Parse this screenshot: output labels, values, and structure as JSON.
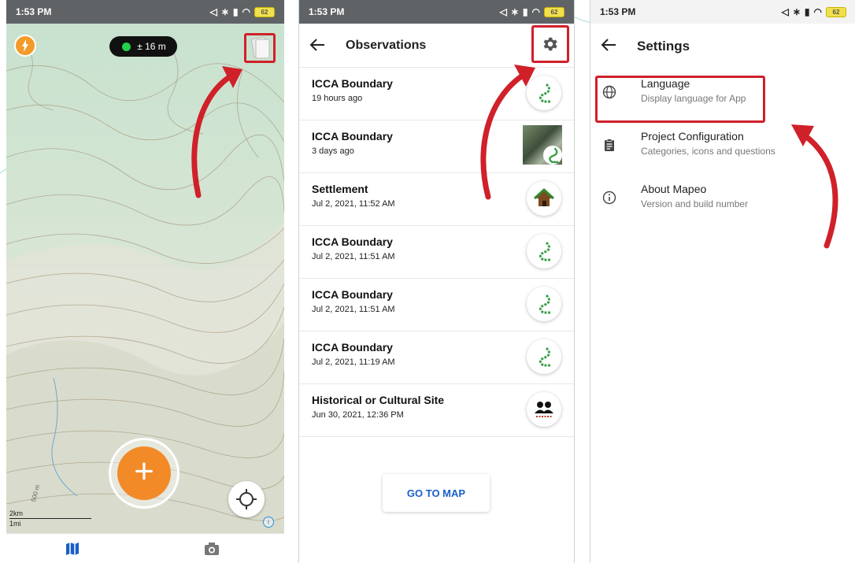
{
  "status": {
    "time": "1:53 PM",
    "battery": "62"
  },
  "map_screen": {
    "gps_accuracy": "± 16 m",
    "scale_metric": "2km",
    "scale_imperial": "1mi",
    "elevation_label": "500 m",
    "add_label": "+",
    "info_label": "i"
  },
  "observations_screen": {
    "title": "Observations",
    "items": [
      {
        "title": "ICCA Boundary",
        "time": "19 hours ago",
        "icon": "boundary-line-icon"
      },
      {
        "title": "ICCA Boundary",
        "time": "3 days ago",
        "icon": "photo-thumbnail"
      },
      {
        "title": "Settlement",
        "time": "Jul 2, 2021, 11:52 AM",
        "icon": "house-icon"
      },
      {
        "title": "ICCA Boundary",
        "time": "Jul 2, 2021, 11:51 AM",
        "icon": "boundary-line-icon"
      },
      {
        "title": "ICCA Boundary",
        "time": "Jul 2, 2021, 11:51 AM",
        "icon": "boundary-line-icon"
      },
      {
        "title": "ICCA Boundary",
        "time": "Jul 2, 2021, 11:19 AM",
        "icon": "boundary-line-icon"
      },
      {
        "title": "Historical or Cultural Site",
        "time": "Jun 30, 2021, 12:36 PM",
        "icon": "people-icon"
      }
    ],
    "goto_map_label": "GO TO MAP"
  },
  "settings_screen": {
    "title": "Settings",
    "items": [
      {
        "title": "Language",
        "subtitle": "Display language for App",
        "icon": "globe-icon"
      },
      {
        "title": "Project Configuration",
        "subtitle": "Categories, icons and questions",
        "icon": "clipboard-icon"
      },
      {
        "title": "About Mapeo",
        "subtitle": "Version and build number",
        "icon": "info-icon"
      }
    ]
  },
  "colors": {
    "accent_orange": "#f28a27",
    "highlight_red": "#d0202a",
    "button_blue": "#1a5fc8",
    "boundary_green": "#3aa04a"
  }
}
